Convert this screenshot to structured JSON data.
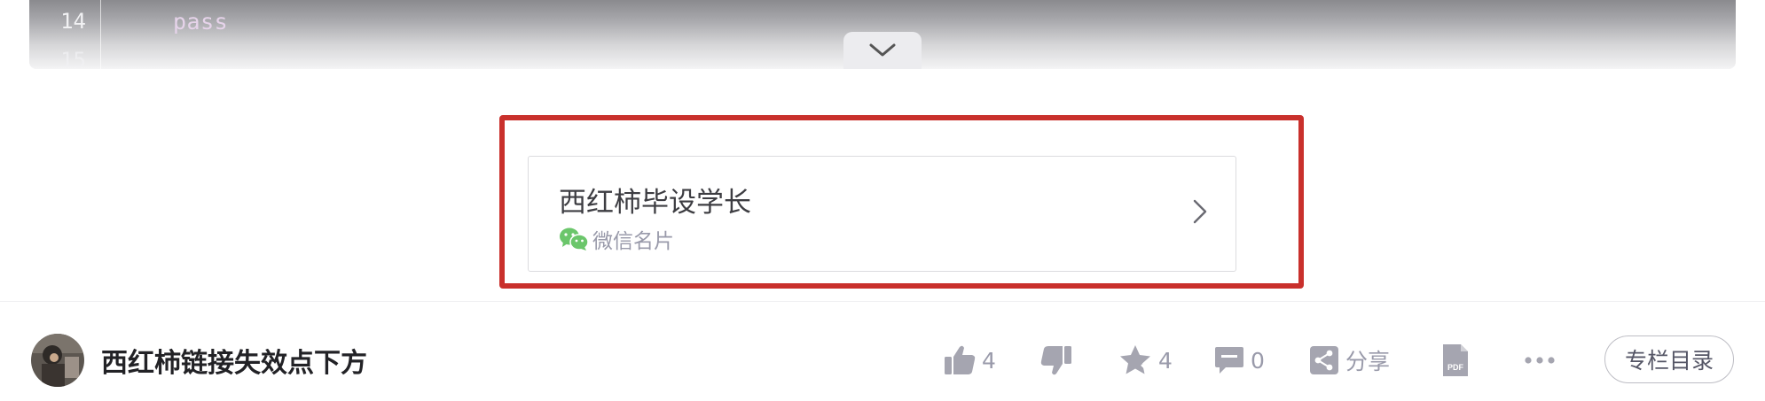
{
  "code_block": {
    "line_numbers": [
      "14",
      "15"
    ],
    "visible_code": "pass",
    "expand_icon": "chevron-down-icon"
  },
  "wechat_card": {
    "title": "西红柿毕设学长",
    "subtitle": "微信名片",
    "icon": "wechat-icon",
    "arrow_icon": "chevron-right-icon",
    "highlight_color": "#c9302c"
  },
  "toolbar": {
    "author_name": "西红柿链接失效点下方",
    "like_count": "4",
    "favorite_count": "4",
    "comment_count": "0",
    "share_label": "分享",
    "catalog_label": "专栏目录",
    "icons": [
      "thumbs-up-icon",
      "thumbs-down-icon",
      "star-icon",
      "comment-icon",
      "share-icon",
      "pdf-icon",
      "more-icon"
    ]
  },
  "colors": {
    "icon_gray": "#a5a5b0",
    "text_gray": "#999aaa",
    "wechat_green": "#6bc66b"
  }
}
